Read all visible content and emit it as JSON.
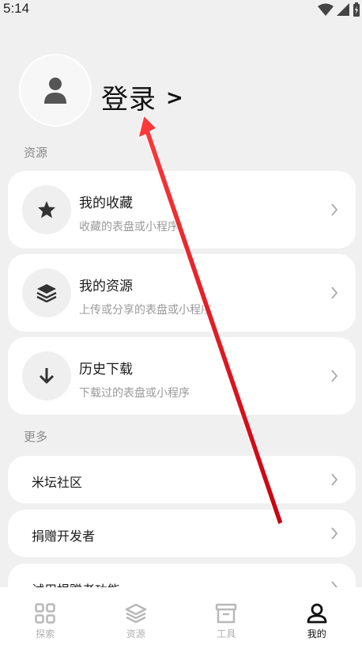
{
  "status": {
    "time": "5:14"
  },
  "profile": {
    "login_label": "登录",
    "login_chevron": ">"
  },
  "sections": {
    "resources_label": "资源",
    "more_label": "更多"
  },
  "resource_items": [
    {
      "title": "我的收藏",
      "subtitle": "收藏的表盘或小程序",
      "icon": "star-icon"
    },
    {
      "title": "我的资源",
      "subtitle": "上传或分享的表盘或小程序",
      "icon": "layers-icon"
    },
    {
      "title": "历史下载",
      "subtitle": "下载过的表盘或小程序",
      "icon": "download-icon"
    }
  ],
  "more_items": [
    {
      "title": "米坛社区"
    },
    {
      "title": "捐赠开发者"
    },
    {
      "title": "试用捐赠者功能"
    }
  ],
  "bottom_nav": [
    {
      "label": "探索",
      "icon": "grid-icon",
      "active": false
    },
    {
      "label": "资源",
      "icon": "layers-icon",
      "active": false
    },
    {
      "label": "工具",
      "icon": "archive-icon",
      "active": false
    },
    {
      "label": "我的",
      "icon": "user-icon",
      "active": true
    }
  ],
  "colors": {
    "accent": "#e8141c",
    "card": "#ffffff",
    "background": "#f0f0f0"
  }
}
